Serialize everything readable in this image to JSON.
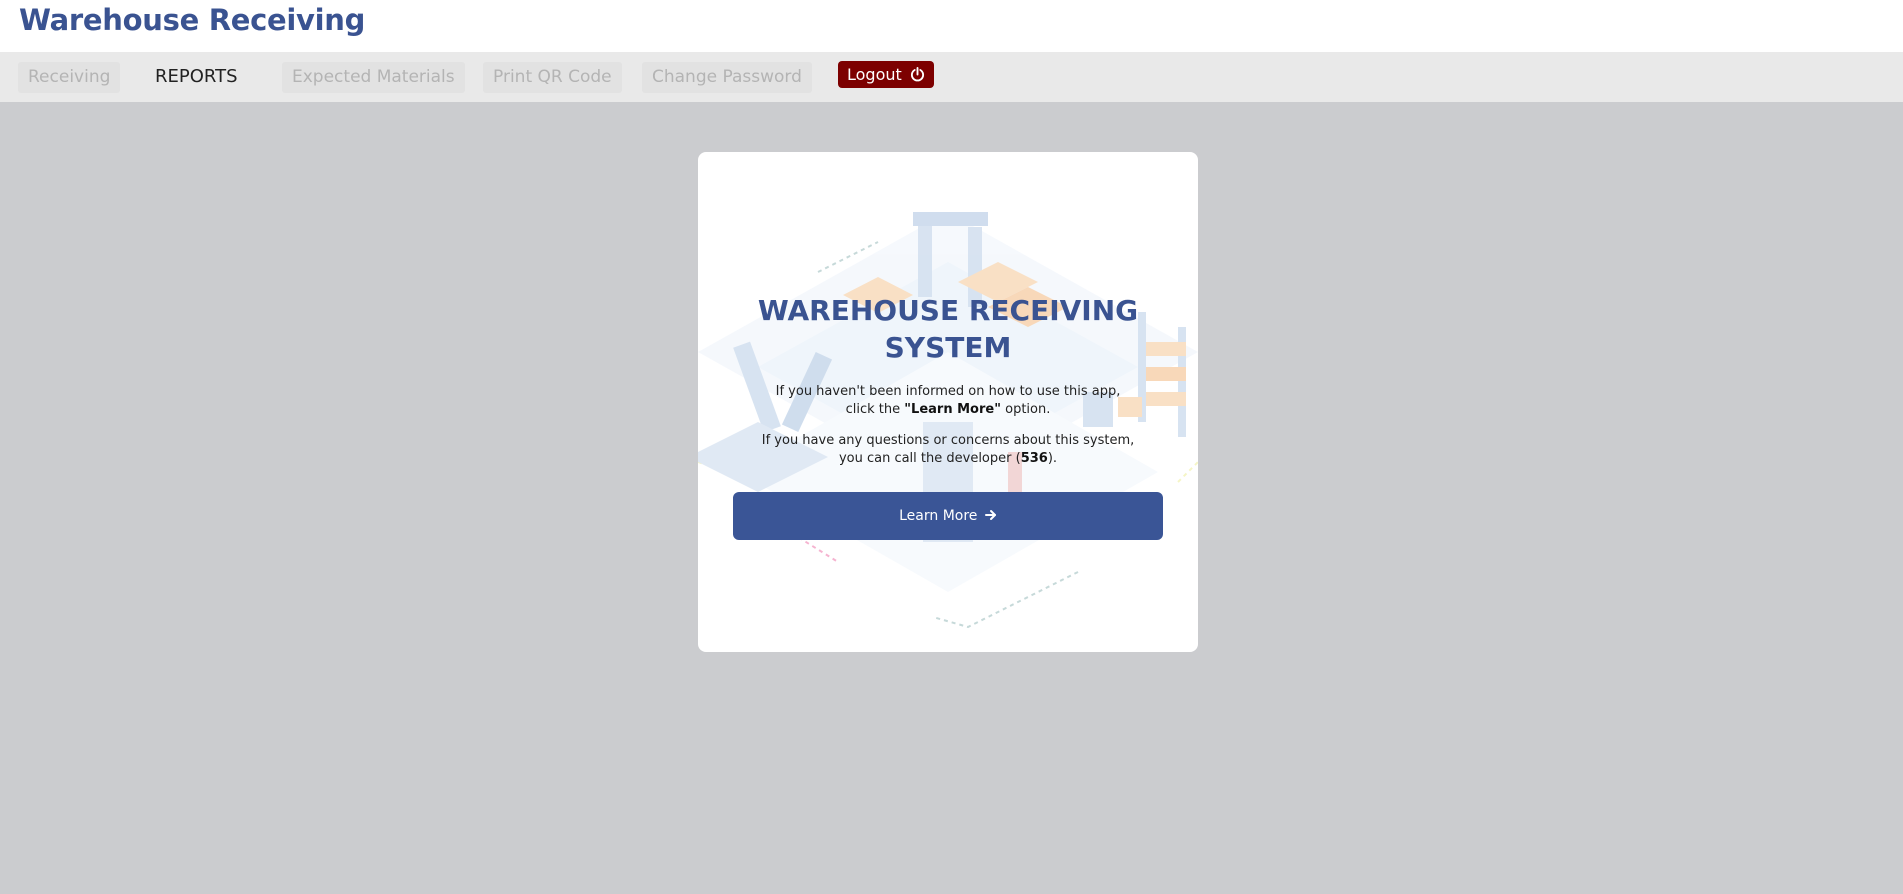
{
  "header": {
    "title": "Warehouse Receiving"
  },
  "nav": {
    "items": [
      {
        "label": "Receiving"
      },
      {
        "label": "REPORTS"
      },
      {
        "label": "Expected Materials"
      },
      {
        "label": "Print QR Code"
      },
      {
        "label": "Change Password"
      }
    ],
    "logout_label": "Logout",
    "logout_icon": "power-icon"
  },
  "card": {
    "title_line1": "WAREHOUSE RECEIVING",
    "title_line2": "SYSTEM",
    "info1_line1": "If you haven't been informed on how to use this app,",
    "info1_pre": "click the ",
    "info1_bold": "\"Learn More\"",
    "info1_post": " option.",
    "info2_line1": "If you have any questions or concerns about this system,",
    "info2_pre": "you can call the developer (",
    "info2_bold": "536",
    "info2_post": ").",
    "button_label": "Learn More",
    "button_icon": "arrow-right-icon"
  },
  "colors": {
    "brand": "#3a5391",
    "button": "#3a5596",
    "logout": "#7d0000",
    "background": "#cbcccf"
  }
}
